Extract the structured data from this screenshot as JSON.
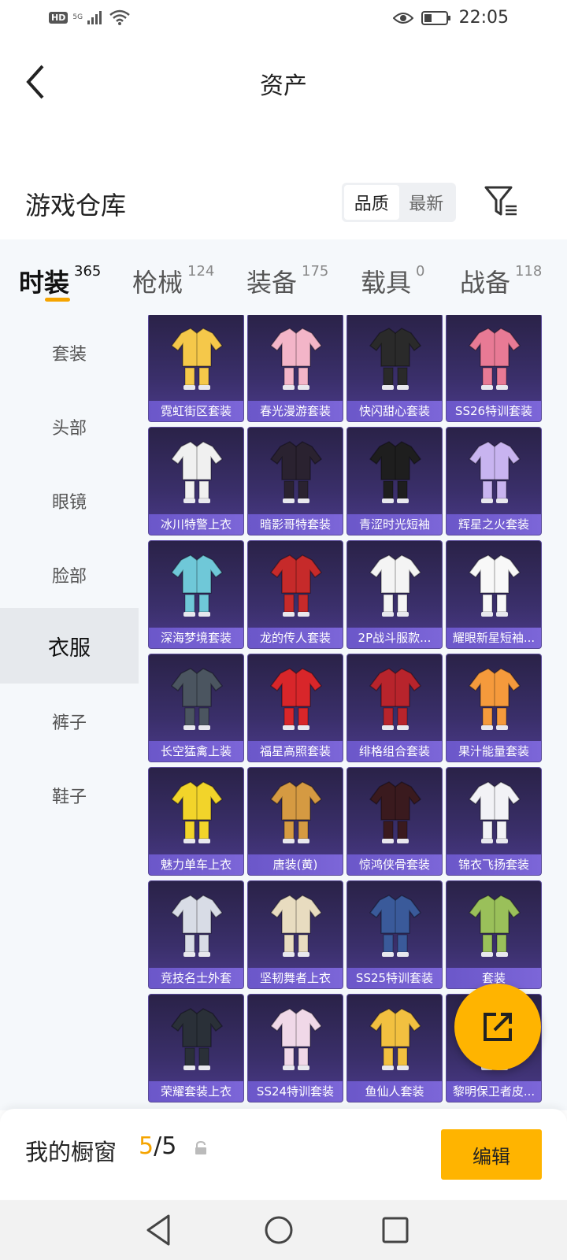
{
  "status_bar": {
    "hd": "HD",
    "network": "5G",
    "time": "22:05"
  },
  "header": {
    "title": "资产"
  },
  "warehouse": {
    "title": "游戏仓库",
    "sort_quality": "品质",
    "sort_latest": "最新"
  },
  "tabs": [
    {
      "label": "时装",
      "count": "365",
      "active": true
    },
    {
      "label": "枪械",
      "count": "124"
    },
    {
      "label": "装备",
      "count": "175"
    },
    {
      "label": "载具",
      "count": "0"
    },
    {
      "label": "战备",
      "count": "118"
    }
  ],
  "sidebar": [
    {
      "label": "套装"
    },
    {
      "label": "头部"
    },
    {
      "label": "眼镜"
    },
    {
      "label": "脸部"
    },
    {
      "label": "衣服",
      "active": true
    },
    {
      "label": "裤子"
    },
    {
      "label": "鞋子"
    }
  ],
  "items": [
    {
      "name": "霓虹街区套装",
      "color": "#f5c84a"
    },
    {
      "name": "春光漫游套装",
      "color": "#f3b5c8"
    },
    {
      "name": "快闪甜心套装",
      "color": "#2a2a2a"
    },
    {
      "name": "SS26特训套装",
      "color": "#e87a95"
    },
    {
      "name": "冰川特警上衣",
      "color": "#f0f0f0"
    },
    {
      "name": "暗影哥特套装",
      "color": "#2a2230"
    },
    {
      "name": "青涩时光短袖",
      "color": "#1e1e1e"
    },
    {
      "name": "辉星之火套装",
      "color": "#c8b4f0"
    },
    {
      "name": "深海梦境套装",
      "color": "#6fc8d8"
    },
    {
      "name": "龙的传人套装",
      "color": "#c62a2a"
    },
    {
      "name": "2P战斗服款...",
      "color": "#f4f4f4"
    },
    {
      "name": "耀眼新星短袖...",
      "color": "#f8f8f8"
    },
    {
      "name": "长空猛禽上装",
      "color": "#4b5560"
    },
    {
      "name": "福星高照套装",
      "color": "#d8262a"
    },
    {
      "name": "绯格组合套装",
      "color": "#b8242c"
    },
    {
      "name": "果汁能量套装",
      "color": "#f59a3c"
    },
    {
      "name": "魅力单车上衣",
      "color": "#f2d42a"
    },
    {
      "name": "唐装(黄)",
      "color": "#d59a42"
    },
    {
      "name": "惊鸿侠骨套装",
      "color": "#3a1a1e"
    },
    {
      "name": "锦衣飞扬套装",
      "color": "#f2f2f6"
    },
    {
      "name": "竞技名士外套",
      "color": "#d8dce6"
    },
    {
      "name": "坚韧舞者上衣",
      "color": "#e8dcc0"
    },
    {
      "name": "SS25特训套装",
      "color": "#3a5a9a"
    },
    {
      "name": "套装",
      "color": "#9ac05a"
    },
    {
      "name": "荣耀套装上衣",
      "color": "#2a3038"
    },
    {
      "name": "SS24特训套装",
      "color": "#f0d8e8"
    },
    {
      "name": "鱼仙人套装",
      "color": "#f2c040"
    },
    {
      "name": "黎明保卫者皮...",
      "color": "#2a2a2a"
    }
  ],
  "bottom": {
    "label": "我的橱窗",
    "current": "5",
    "separator": "/",
    "total": "5",
    "edit": "编辑"
  }
}
